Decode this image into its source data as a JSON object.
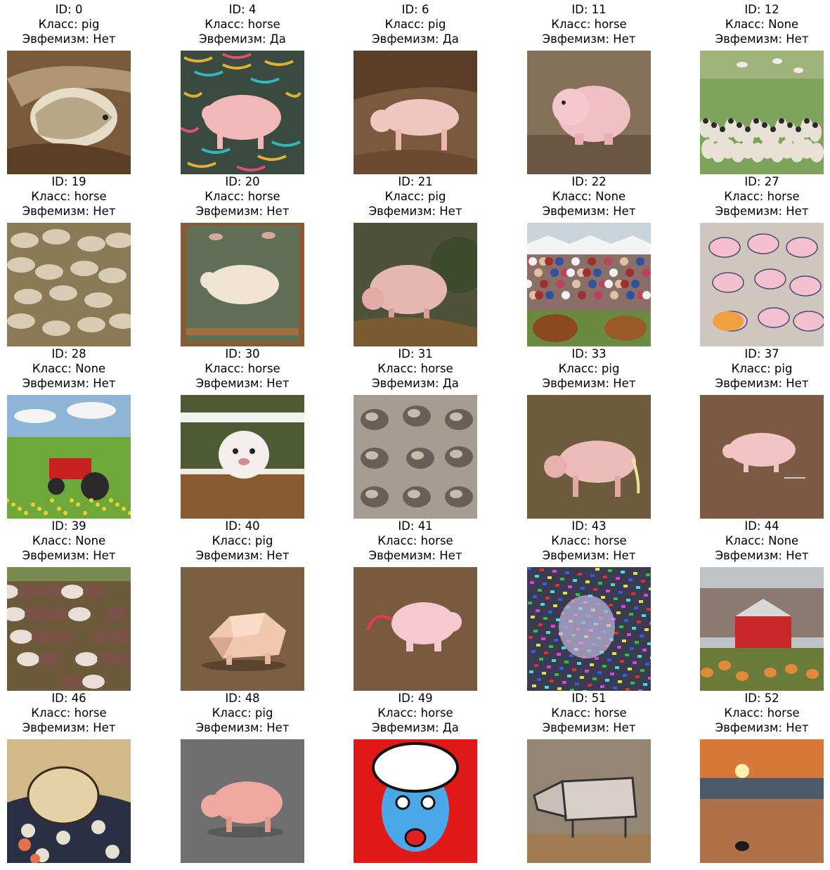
{
  "items": [
    {
      "id": "ID: 0",
      "cls": "Класс: pig",
      "euph": "Эвфемизм: Нет",
      "scene": "boar-sketch",
      "bg": "#7a5a3a"
    },
    {
      "id": "ID: 4",
      "cls": "Класс: horse",
      "euph": "Эвфемизм: Да",
      "scene": "pattern-pig",
      "bg": "#3a4a40"
    },
    {
      "id": "ID: 6",
      "cls": "Класс: pig",
      "euph": "Эвфемизм: Да",
      "scene": "mud-pig",
      "bg": "#7a5a3e"
    },
    {
      "id": "ID: 11",
      "cls": "Класс: horse",
      "euph": "Эвфемизм: Нет",
      "scene": "toy-pig",
      "bg": "#85705a"
    },
    {
      "id": "ID: 12",
      "cls": "Класс: None",
      "euph": "Эвфемизм: Нет",
      "scene": "sheep-field",
      "bg": "#7ea35a"
    },
    {
      "id": "ID: 19",
      "cls": "Класс: horse",
      "euph": "Эвфемизм: Нет",
      "scene": "herd",
      "bg": "#8a7a55"
    },
    {
      "id": "ID: 20",
      "cls": "Класс: horse",
      "euph": "Эвфемизм: Нет",
      "scene": "tapestry",
      "bg": "#5f6e55"
    },
    {
      "id": "ID: 21",
      "cls": "Класс: pig",
      "euph": "Эвфемизм: Нет",
      "scene": "painted-pig",
      "bg": "#4e5238"
    },
    {
      "id": "ID: 22",
      "cls": "Класс: None",
      "euph": "Эвфемизм: Нет",
      "scene": "fair-crowd",
      "bg": "#c9d4dc"
    },
    {
      "id": "ID: 27",
      "cls": "Класс: horse",
      "euph": "Эвфемизм: Нет",
      "scene": "doodles",
      "bg": "#cfc6bd"
    },
    {
      "id": "ID: 28",
      "cls": "Класс: None",
      "euph": "Эвфемизм: Нет",
      "scene": "tractor",
      "bg": "#8fb5d6"
    },
    {
      "id": "ID: 30",
      "cls": "Класс: horse",
      "euph": "Эвфемизм: Нет",
      "scene": "fence-pup",
      "bg": "#4e5a33"
    },
    {
      "id": "ID: 31",
      "cls": "Класс: horse",
      "euph": "Эвфемизм: Да",
      "scene": "sketch-sheet",
      "bg": "#a59c92"
    },
    {
      "id": "ID: 33",
      "cls": "Класс: pig",
      "euph": "Эвфемизм: Нет",
      "scene": "straw-pig",
      "bg": "#6e5a3c"
    },
    {
      "id": "ID: 37",
      "cls": "Класс: pig",
      "euph": "Эвфемизм: Нет",
      "scene": "flat-pig",
      "bg": "#7b5a43"
    },
    {
      "id": "ID: 39",
      "cls": "Класс: None",
      "euph": "Эвфемизм: Нет",
      "scene": "turkeys",
      "bg": "#6d5a3a"
    },
    {
      "id": "ID: 40",
      "cls": "Класс: pig",
      "euph": "Эвфемизм: Нет",
      "scene": "lowpoly-pig",
      "bg": "#7a5f43"
    },
    {
      "id": "ID: 41",
      "cls": "Класс: horse",
      "euph": "Эвфемизм: Нет",
      "scene": "cartoon-pig",
      "bg": "#7a5a3f"
    },
    {
      "id": "ID: 43",
      "cls": "Класс: horse",
      "euph": "Эвфемизм: Нет",
      "scene": "noise",
      "bg": "#3a3a50"
    },
    {
      "id": "ID: 44",
      "cls": "Класс: None",
      "euph": "Эвфемизм: Нет",
      "scene": "barn",
      "bg": "#bfc3c5"
    },
    {
      "id": "ID: 46",
      "cls": "Класс: horse",
      "euph": "Эвфемизм: Нет",
      "scene": "woodblock",
      "bg": "#d2b98a"
    },
    {
      "id": "ID: 48",
      "cls": "Класс: pig",
      "euph": "Эвфемизм: Нет",
      "scene": "render-pig",
      "bg": "#6f6f6f"
    },
    {
      "id": "ID: 49",
      "cls": "Класс: horse",
      "euph": "Эвфемизм: Да",
      "scene": "popart-face",
      "bg": "#e01818"
    },
    {
      "id": "ID: 51",
      "cls": "Класс: horse",
      "euph": "Эвфемизм: Нет",
      "scene": "line-animal",
      "bg": "#948575"
    },
    {
      "id": "ID: 52",
      "cls": "Класс: horse",
      "euph": "Эвфемизм: Нет",
      "scene": "beach-sunset",
      "bg": "#7a4a30"
    }
  ]
}
